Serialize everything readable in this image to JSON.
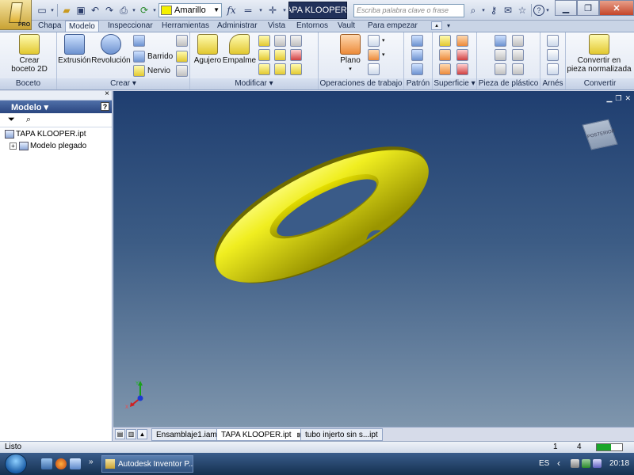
{
  "titlebar": {
    "app_pro_label": "PRO",
    "color_select": {
      "value": "Amarillo",
      "swatch": "#f4f000"
    },
    "document_title": "TAPA KLOOPER...",
    "help_search_placeholder": "Escriba palabra clave o frase",
    "help_icon": "?"
  },
  "tabs": [
    "Chapa",
    "Modelo",
    "Inspeccionar",
    "Herramientas",
    "Administrar",
    "Vista",
    "Entornos",
    "Vault",
    "Para empezar"
  ],
  "active_tab": "Modelo",
  "ribbon": {
    "boceto": {
      "label": "Boceto",
      "create_sketch": "Crear\nboceto 2D"
    },
    "crear": {
      "label": "Crear ▾",
      "extrusion": "Extrusión",
      "revolucion": "Revolución",
      "barrido": "Barrido",
      "nervio": "Nervio"
    },
    "modificar": {
      "label": "Modificar ▾",
      "agujero": "Agujero",
      "empalme": "Empalme"
    },
    "operaciones": {
      "label": "Operaciones de trabajo",
      "plano": "Plano"
    },
    "patron": {
      "label": "Patrón"
    },
    "superficie": {
      "label": "Superficie ▾"
    },
    "pieza_plastico": {
      "label": "Pieza de plástico"
    },
    "arnes": {
      "label": "Arnés"
    },
    "convertir": {
      "label": "Convertir",
      "convert_button": "Convertir en\npieza normalizada"
    }
  },
  "browser": {
    "title": "Modelo ▾",
    "help": "?",
    "close": "×",
    "tree": [
      {
        "label": "TAPA KLOOPER.ipt",
        "level": 0
      },
      {
        "label": "Modelo plegado",
        "level": 1,
        "expander": "+"
      }
    ]
  },
  "viewport": {
    "viewcube_label": "POSTERIOR",
    "triad_labels": {
      "x": "X",
      "y": "Y"
    },
    "model_color": "#e6e000",
    "background_top": "#1f3e70",
    "background_bottom": "#7f96ad"
  },
  "doc_tabs": [
    {
      "label": "Ensamblaje1.iam",
      "active": false
    },
    {
      "label": "TAPA KLOOPER.ipt",
      "active": true,
      "close": "⊠"
    },
    {
      "label": "tubo injerto  sin s...ipt",
      "active": false
    }
  ],
  "status": {
    "text": "Listo",
    "value1": "1",
    "value2": "4",
    "meter_fraction": 0.55
  },
  "taskbar": {
    "task_button": "Autodesk Inventor P...",
    "language": "ES",
    "clock": "20:18"
  }
}
